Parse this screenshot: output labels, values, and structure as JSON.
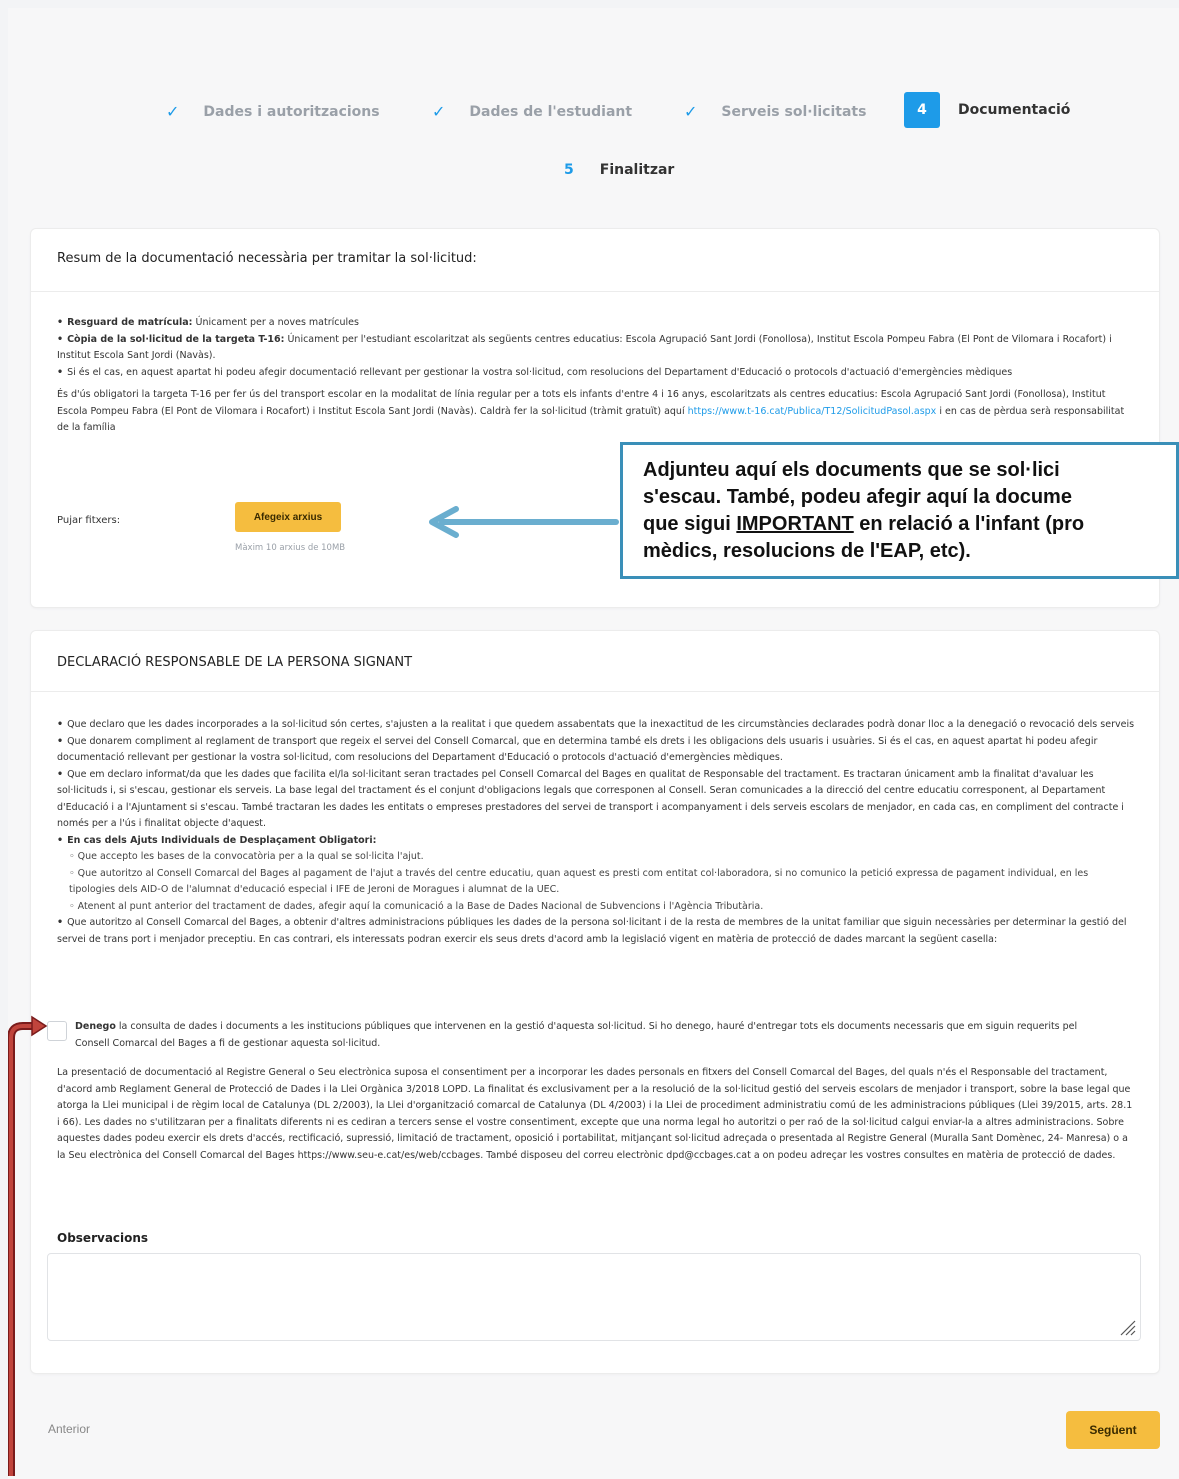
{
  "stepper": {
    "steps": [
      {
        "label": "Dades i autoritzacions",
        "state": "done"
      },
      {
        "label": "Dades de l'estudiant",
        "state": "done"
      },
      {
        "label": "Serveis sol·licitats",
        "state": "done"
      },
      {
        "number": "4",
        "label": "Documentació",
        "state": "active"
      },
      {
        "number": "5",
        "label": "Finalitzar",
        "state": "pending"
      }
    ]
  },
  "documentation": {
    "title": "Resum de la documentació necessària per tramitar la sol·licitud:",
    "bullets": [
      {
        "bold": "Resguard de matrícula:",
        "text": " Únicament per a noves matrícules"
      },
      {
        "bold": "Còpia de la sol·licitud de la targeta T-16:",
        "text": " Únicament per l'estudiant escolaritzat als següents centres educatius: Escola Agrupació Sant Jordi (Fonollosa), Institut Escola Pompeu Fabra (El Pont de Vilomara i Rocafort) i Institut Escola Sant Jordi (Navàs)."
      },
      {
        "bold": "",
        "text": "Si és el cas, en aquest apartat hi podeu afegir documentació rellevant per gestionar la vostra sol·licitud, com resolucions del Departament d'Educació o protocols d'actuació d'emergències mèdiques"
      }
    ],
    "t16_paragraph": "És d'ús obligatori la targeta T-16 per fer ús del transport escolar en la modalitat de línia regular per a tots els infants d'entre 4 i 16 anys, escolaritzats als centres educatius: Escola Agrupació Sant Jordi (Fonollosa), Institut Escola Pompeu Fabra (El Pont de Vilomara i Rocafort) i Institut Escola Sant Jordi (Navàs). Caldrà fer la sol·licitud (tràmit gratuït) aquí ",
    "t16_link": "https://www.t-16.cat/Publica/T12/SolicitudPasol.aspx",
    "t16_tail": " i en cas de pèrdua serà responsabilitat de la família",
    "upload_label": "Pujar fitxers:",
    "upload_button": "Afegeix arxius",
    "upload_hint": "Màxim 10 arxius de 10MB"
  },
  "callout": {
    "line1": "Adjunteu aquí els documents que se sol·lici",
    "line2": "s'escau. També, podeu afegir aquí la docume",
    "line3_pre": "que sigui ",
    "line3_u": "IMPORTANT",
    "line3_post": " en relació a l'infant (pro",
    "line4": "mèdics, resolucions de l'EAP, etc)."
  },
  "declaration": {
    "title": "DECLARACIÓ RESPONSABLE DE LA PERSONA SIGNANT",
    "b1": "Que declaro que les dades incorporades a la sol·licitud són certes, s'ajusten a la realitat i que quedem assabentats que la inexactitud de les circumstàncies declarades podrà donar lloc a la denegació o revocació dels serveis",
    "b2": "Que donarem compliment al reglament de transport que regeix el servei del Consell Comarcal, que en determina també els drets i les obligacions dels usuaris i usuàries. Si és el cas, en aquest apartat hi podeu afegir documentació rellevant per gestionar la vostra sol·licitud, com resolucions del Departament d'Educació o protocols d'actuació d'emergències mèdiques.",
    "b3": "Que em declaro informat/da que les dades que facilita el/la sol·licitant seran tractades pel Consell Comarcal del Bages en qualitat de Responsable del tractament. Es tractaran únicament amb la finalitat d'avaluar les sol·licituds i, si s'escau, gestionar els serveis. La base legal del tractament és el conjunt d'obligacions legals que corresponen al Consell. Seran comunicades a la direcció del centre educatiu corresponent, al Departament d'Educació i a l'Ajuntament si s'escau. També tractaran les dades les entitats o empreses prestadores del servei de transport i acompanyament i dels serveis escolars de menjador, en cada cas, en compliment del contracte i només per a l'ús i finalitat objecte d'aquest.",
    "b4_title": "En cas dels Ajuts Individuals de Desplaçament Obligatori:",
    "sub1": "Que accepto les bases de la convocatòria per a la qual se sol·licita l'ajut.",
    "sub2": "Que autoritzo al Consell Comarcal del Bages al pagament de l'ajut a través del centre educatiu, quan aquest es presti com entitat col·laboradora, si no comunico la petició expressa de pagament individual, en les tipologies dels AID-O de l'alumnat d'educació especial i IFE de Jeroni de Moragues i alumnat de la UEC.",
    "sub3": "Atenent al punt anterior del tractament de dades, afegir aquí la comunicació a la Base de Dades Nacional de Subvencions i l'Agència Tributària.",
    "b5": "Que autoritzo al Consell Comarcal del Bages, a obtenir d'altres administracions públiques les dades de la persona sol·licitant i de la resta de membres de la unitat familiar que siguin necessàries per determinar la gestió del servei de trans port i menjador preceptiu. En cas contrari, els interessats podran exercir els seus drets d'acord amb la legislació vigent en matèria de protecció de dades marcant la següent casella:",
    "deny_bold": "Denego",
    "deny_text": " la consulta de dades i documents a les institucions públiques que intervenen en la gestió d'aquesta sol·licitud. Si ho denego, hauré d'entregar tots els documents necessaris que em siguin requerits pel Consell Comarcal del Bages a fi de gestionar aquesta sol·licitud.",
    "privacy": "La presentació de documentació al Registre General o Seu electrònica suposa el consentiment per a incorporar les dades personals en fitxers del Consell Comarcal del Bages, del quals n'és el Responsable del tractament, d'acord amb Reglament General de Protecció de Dades i la Llei Orgànica 3/2018 LOPD. La finalitat és exclusivament per a la resolució de la sol·licitud gestió del serveis escolars de menjador i transport, sobre la base legal que atorga la Llei municipal i de règim local de Catalunya (DL 2/2003), la Llei d'organització comarcal de Catalunya (DL 4/2003) i la Llei de procediment administratiu comú de les administracions públiques (Llei 39/2015, arts. 28.1 i 66). Les dades no s'utilitzaran per a finalitats diferents ni es cediran a tercers sense el vostre consentiment, excepte que una norma legal ho autoritzi o per raó de la sol·licitud calgui enviar-la a altres administracions. Sobre aquestes dades podeu exercir els drets d'accés, rectificació, supressió, limitació de tractament, oposició i portabilitat, mitjançant sol·licitud adreçada o presentada al Registre General (Muralla Sant Domènec, 24- Manresa) o a la Seu electrònica del Consell Comarcal del Bages https://www.seu-e.cat/es/web/ccbages. També disposeu del correu electrònic dpd@ccbages.cat a on podeu adreçar les vostres consultes en matèria de protecció de dades.",
    "observations_label": "Observacions",
    "observations_value": ""
  },
  "nav": {
    "prev_label": "Anterior",
    "next_label": "Següent"
  },
  "colors": {
    "accent": "#1e9be8",
    "button": "#f5bd3f",
    "callout_border": "#3a8fb8",
    "arrow": "#6aaecf",
    "bracket": "#9b2a2a"
  }
}
